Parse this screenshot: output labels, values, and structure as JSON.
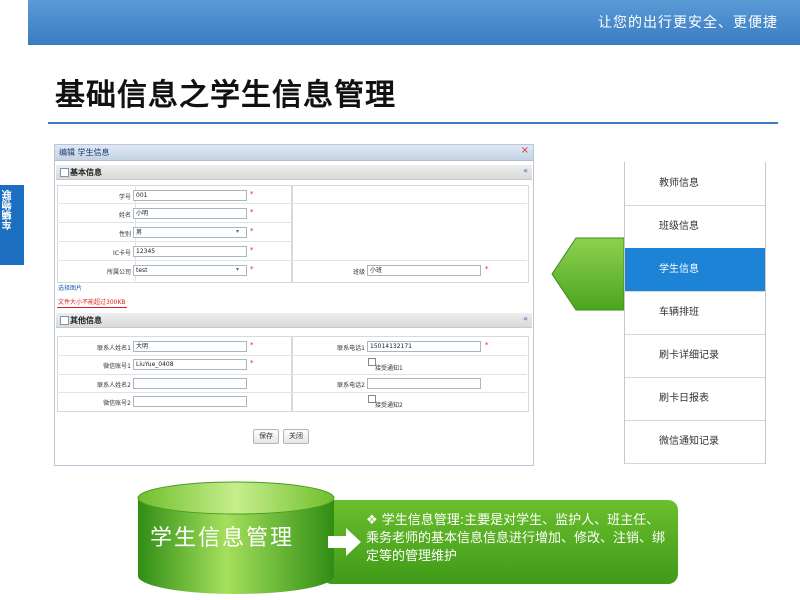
{
  "banner": {
    "slogan": "让您的出行更安全、更便捷"
  },
  "side_tab": {
    "label": "车辆物联"
  },
  "page_title": "基础信息之学生信息管理",
  "form_window": {
    "title": "编辑  学生信息",
    "close_icon": "×",
    "basic_section": {
      "title": "基本信息",
      "collapse_icon": "«",
      "fields": {
        "student_no": {
          "label": "学号",
          "value": "001"
        },
        "name": {
          "label": "姓名",
          "value": "小明"
        },
        "gender": {
          "label": "性别",
          "value": "男"
        },
        "ic_card": {
          "label": "IC卡号",
          "value": "12345"
        },
        "company": {
          "label": "所属公司",
          "value": "test"
        },
        "class": {
          "label": "班级",
          "value": "小班"
        }
      },
      "required_mark": "*",
      "photo_link": "选择图片",
      "photo_note": "文件大小不能超过300KB"
    },
    "other_section": {
      "title": "其他信息",
      "collapse_icon": "«",
      "fields": {
        "contact1_name": {
          "label": "联系人姓名1",
          "value": "大明"
        },
        "contact1_phone": {
          "label": "联系电话1",
          "value": "15014132171"
        },
        "wechat1": {
          "label": "微信账号1",
          "value": "LiuYue_0408"
        },
        "notify1": {
          "label": "接受通知1"
        },
        "contact2_name": {
          "label": "联系人姓名2",
          "value": ""
        },
        "contact2_phone": {
          "label": "联系电话2",
          "value": ""
        },
        "wechat2": {
          "label": "微信账号2",
          "value": ""
        },
        "notify2": {
          "label": "接受通知2"
        }
      }
    },
    "buttons": {
      "save": "保存",
      "close": "关闭"
    }
  },
  "menu": {
    "items": [
      "教师信息",
      "班级信息",
      "学生信息",
      "车辆排班",
      "刷卡详细记录",
      "刷卡日报表",
      "微信通知记录"
    ],
    "active_index": 2
  },
  "summary": {
    "cylinder_label": "学生信息管理",
    "bullet": "❖",
    "description": "学生信息管理:主要是对学生、监护人、班主任、乘务老师的基本信息信息进行增加、修改、注销、绑定等的管理维护"
  },
  "colors": {
    "accent": "#1c83d6",
    "banner": "#3a7cc3",
    "green": "#4aa51f"
  }
}
